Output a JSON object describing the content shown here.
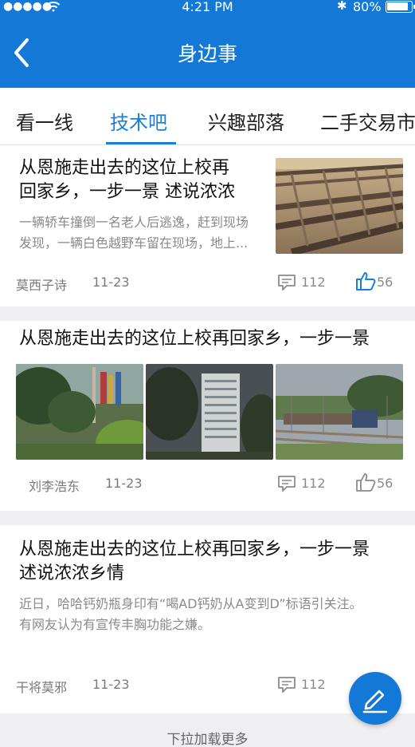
{
  "status_bar": {
    "signal": "●●●●●",
    "wifi": "≋",
    "time": "4:21 PM",
    "bluetooth": "✱",
    "battery": "80%"
  },
  "header": {
    "title": "身边事"
  },
  "tabs": [
    {
      "label": "看一线"
    },
    {
      "label": "技术吧",
      "active": true
    },
    {
      "label": "兴趣部落"
    },
    {
      "label": "二手交易市场"
    }
  ],
  "articles": [
    {
      "title_line1": "从恩施走出去的这位上校再",
      "title_line2": "回家乡，一步一景 述说浓浓",
      "desc_line1": "一辆轿车撞倒一名老人后逃逸，赶到现场",
      "desc_line2": "发现，一辆白色越野车留在现场，地上...",
      "author": "莫西子诗",
      "date": "11-23",
      "comments": "112",
      "likes": "56",
      "liked": true,
      "image": "railway-tracks-photo"
    },
    {
      "title_line1": "从恩施走出去的这位上校再回家乡，一步一景",
      "author": "刘李浩东",
      "date": "11-23",
      "comments": "112",
      "likes": "56",
      "liked": false,
      "images": [
        "tropical-garden-photo",
        "office-building-photo",
        "train-photo"
      ]
    },
    {
      "title_line1": "从恩施走出去的这位上校再回家乡，一步一景",
      "title_line2": "述说浓浓乡情",
      "desc_line1": "近日，哈哈钙奶瓶身印有“喝AD钙奶从A变到D”标语引关注。",
      "desc_line2": "有网友认为有宣传丰胸功能之嫌。",
      "author": "干将莫邪",
      "date": "11-23",
      "comments": "112"
    }
  ],
  "fab": {
    "icon": "edit-icon"
  },
  "footer": {
    "load_more": "下拉加载更多"
  },
  "colors": {
    "brand": "#1479d6",
    "active_tab": "#1b7fd9",
    "background": "#efeff1"
  }
}
